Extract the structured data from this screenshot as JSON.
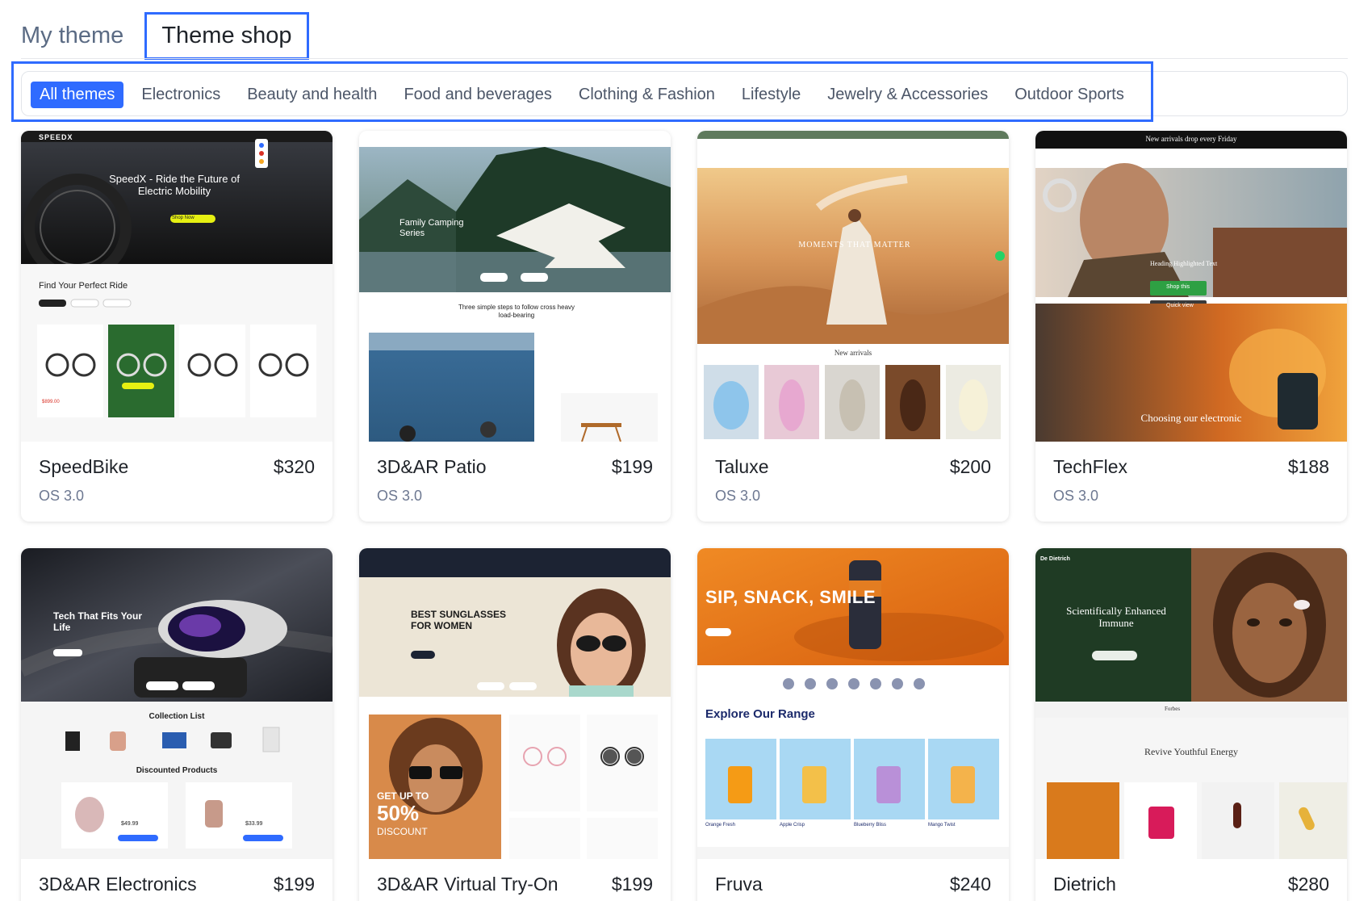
{
  "tabs": [
    {
      "label": "My theme",
      "active": false
    },
    {
      "label": "Theme shop",
      "active": true
    }
  ],
  "categories": [
    {
      "label": "All themes",
      "active": true
    },
    {
      "label": "Electronics"
    },
    {
      "label": "Beauty and health"
    },
    {
      "label": "Food and beverages"
    },
    {
      "label": "Clothing & Fashion"
    },
    {
      "label": "Lifestyle"
    },
    {
      "label": "Jewelry & Accessories"
    },
    {
      "label": "Outdoor Sports"
    }
  ],
  "themes": [
    {
      "name": "SpeedBike",
      "price": "$320",
      "os": "OS 3.0",
      "preview": {
        "brand": "SPEEDX",
        "hero": "SpeedX - Ride the Future of Electric Mobility",
        "section": "Find Your Perfect Ride",
        "button": "Shop Now",
        "price": "$899.00"
      }
    },
    {
      "name": "3D&AR Patio",
      "price": "$199",
      "os": "OS 3.0",
      "preview": {
        "hero": "Family Camping Series",
        "section": "Three simple steps to follow cross heavy load-bearing"
      }
    },
    {
      "name": "Taluxe",
      "price": "$200",
      "os": "OS 3.0",
      "preview": {
        "hero": "MOMENTS THAT MATTER",
        "section": "New arrivals"
      }
    },
    {
      "name": "TechFlex",
      "price": "$188",
      "os": "OS 3.0",
      "preview": {
        "banner": "New arrivals drop every Friday",
        "hero": "Heading Highlighted Text",
        "button": "Shop this",
        "button2": "Quick view",
        "section": "Choosing our electronic"
      }
    },
    {
      "name": "3D&AR Electronics",
      "price": "$199",
      "os": "",
      "preview": {
        "hero": "Tech That Fits Your Life",
        "section": "Collection List",
        "section2": "Discounted Products",
        "price": "$49.99",
        "price2": "$33.99"
      }
    },
    {
      "name": "3D&AR Virtual Try-On",
      "price": "$199",
      "os": "",
      "preview": {
        "hero": "BEST SUNGLASSES FOR WOMEN",
        "promo": "GET UP TO",
        "promo_value": "50%",
        "promo_label": "DISCOUNT"
      }
    },
    {
      "name": "Fruva",
      "price": "$240",
      "os": "",
      "preview": {
        "hero": "SIP, SNACK, SMILE",
        "section": "Explore Our Range",
        "items": [
          "Orange Fresh",
          "Apple Crisp",
          "Blueberry Bliss",
          "Mango Twist"
        ]
      }
    },
    {
      "name": "Dietrich",
      "price": "$280",
      "os": "",
      "preview": {
        "brand": "De Dietrich",
        "hero": "Scientifically Enhanced Immune",
        "section": "Revive Youthful Energy",
        "press": [
          "Forbes"
        ]
      }
    }
  ],
  "colors": {
    "accent": "#2f6bff",
    "muted_text": "#6d7891",
    "price_red": "#d93025"
  }
}
